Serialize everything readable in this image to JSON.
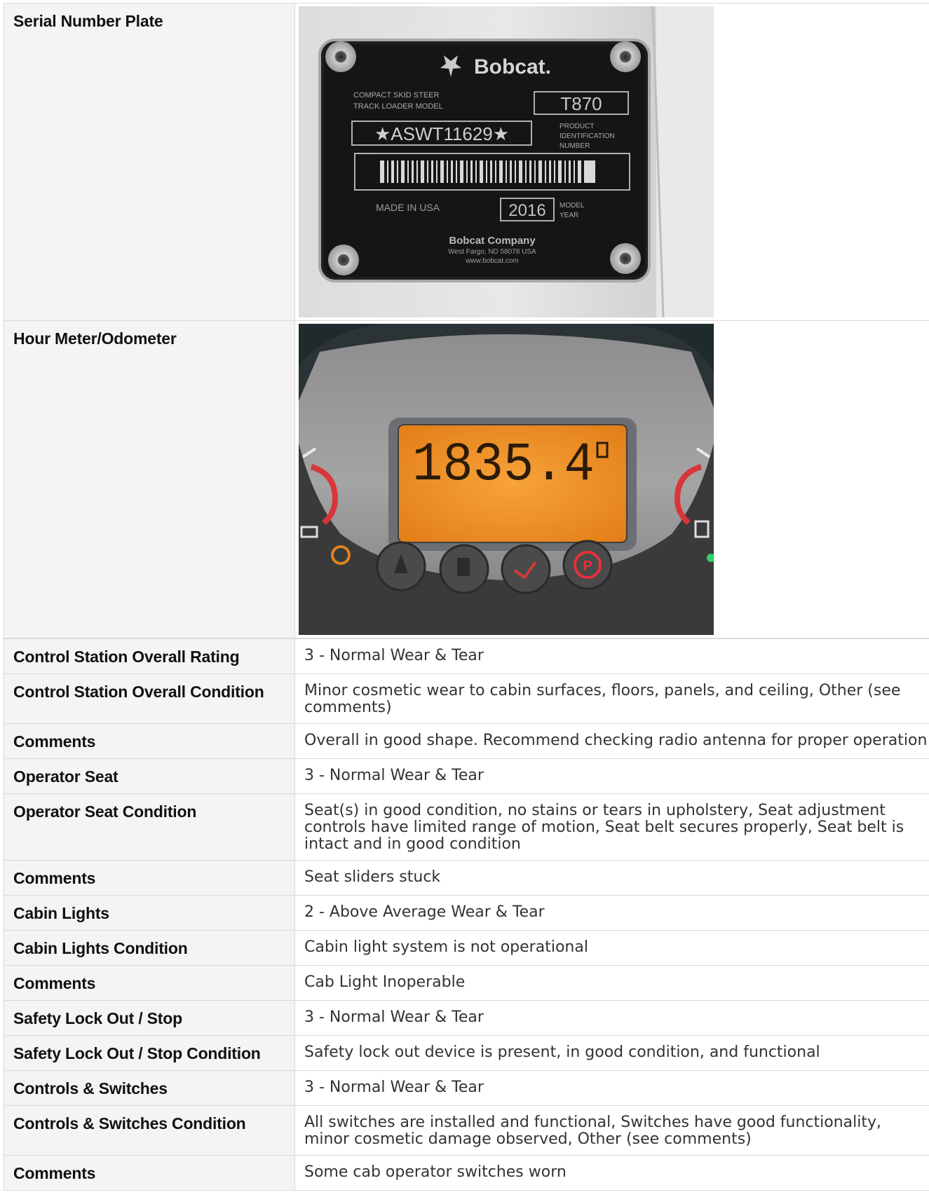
{
  "photo_rows": [
    {
      "label": "Serial Number Plate",
      "plate": {
        "brand": "Bobcat.",
        "model_caption_1": "COMPACT SKID STEER",
        "model_caption_2": "TRACK LOADER MODEL",
        "model": "T870",
        "pin": "★ASWT11629★",
        "pin_caption_1": "PRODUCT",
        "pin_caption_2": "IDENTIFICATION",
        "pin_caption_3": "NUMBER",
        "made_in": "MADE IN USA",
        "year": "2016",
        "year_caption_1": "MODEL",
        "year_caption_2": "YEAR",
        "company": "Bobcat Company",
        "address": "West Fargo, ND 58078 USA",
        "website": "www.bobcat.com"
      }
    },
    {
      "label": "Hour Meter/Odometer",
      "meter": {
        "reading": "1835.4",
        "display_color": "#f39a2c"
      }
    }
  ],
  "rows": [
    {
      "label": "Control Station Overall Rating",
      "value": "3 - Normal Wear & Tear"
    },
    {
      "label": "Control Station Overall Condition",
      "value": "Minor cosmetic wear to cabin surfaces, floors, panels, and ceiling, Other (see comments)"
    },
    {
      "label": "Comments",
      "value": "Overall in good shape. Recommend checking radio antenna for proper operation"
    },
    {
      "label": "Operator Seat",
      "value": "3 - Normal Wear & Tear"
    },
    {
      "label": "Operator Seat Condition",
      "value": "Seat(s) in good condition, no stains or tears in upholstery, Seat adjustment controls have limited range of motion, Seat belt secures properly, Seat belt is intact and in good condition"
    },
    {
      "label": "Comments",
      "value": "Seat sliders stuck"
    },
    {
      "label": "Cabin Lights",
      "value": "2 - Above Average Wear & Tear"
    },
    {
      "label": "Cabin Lights Condition",
      "value": "Cabin light system is not operational"
    },
    {
      "label": "Comments",
      "value": "Cab Light Inoperable"
    },
    {
      "label": "Safety Lock Out / Stop",
      "value": "3 - Normal Wear & Tear"
    },
    {
      "label": "Safety Lock Out / Stop Condition",
      "value": "Safety lock out device is present, in good condition, and functional"
    },
    {
      "label": "Controls & Switches",
      "value": "3 - Normal Wear & Tear"
    },
    {
      "label": "Controls & Switches Condition",
      "value": "All switches are installed and functional, Switches have good functionality, minor cosmetic damage observed, Other (see comments)"
    },
    {
      "label": "Comments",
      "value": "Some cab operator switches worn"
    }
  ]
}
